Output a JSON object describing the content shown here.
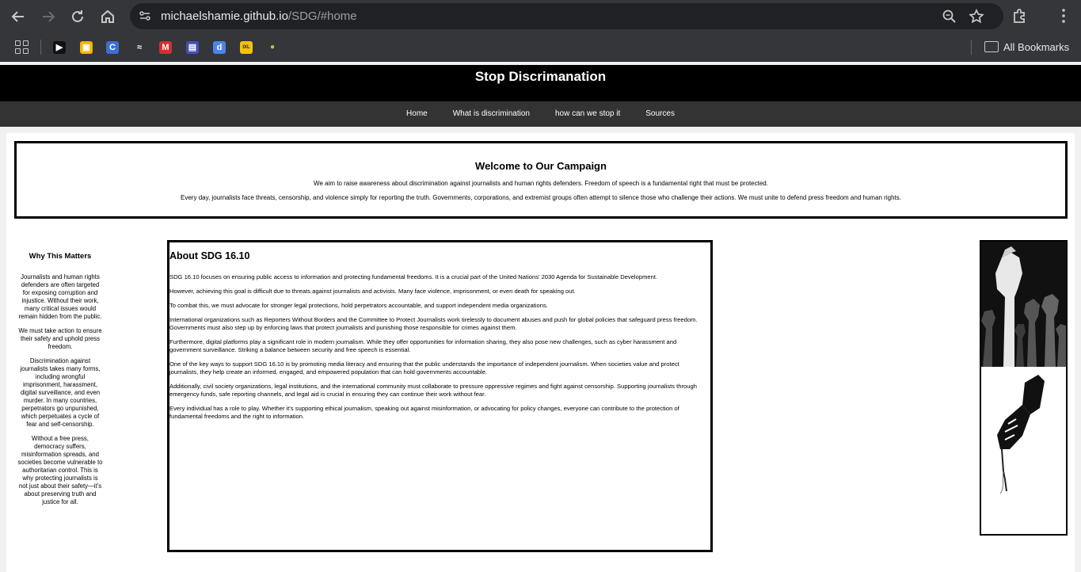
{
  "browser": {
    "url_host": "michaelshamie.github.io",
    "url_path": "/SDG/#home",
    "all_bookmarks_label": "All Bookmarks",
    "bookmarks": [
      {
        "icon": "play-favicon",
        "color": "#111111",
        "glyph": "▶"
      },
      {
        "icon": "slides-favicon",
        "color": "#f4b400",
        "glyph": "▣"
      },
      {
        "icon": "c-favicon",
        "color": "#3b6fd4",
        "glyph": "C"
      },
      {
        "icon": "fish-favicon",
        "color": "#35363a",
        "glyph": "≈"
      },
      {
        "icon": "m-favicon",
        "color": "#d32f2f",
        "glyph": "M"
      },
      {
        "icon": "board-favicon",
        "color": "#3f51b5",
        "glyph": "▤"
      },
      {
        "icon": "d-favicon",
        "color": "#4a86e8",
        "glyph": "d"
      },
      {
        "icon": "ixl-favicon",
        "color": "#f4c20d",
        "glyph": "IXL"
      },
      {
        "icon": "drop-favicon",
        "color": "#35363a",
        "glyph": "●"
      }
    ]
  },
  "site": {
    "title": "Stop Discrimanation",
    "nav": [
      "Home",
      "What is discrimination",
      "how can we stop it",
      "Sources"
    ]
  },
  "welcome": {
    "heading": "Welcome to Our Campaign",
    "p1": "We aim to raise awareness about discrimination against journalists and human rights defenders. Freedom of speech is a fundamental right that must be protected.",
    "p2": "Every day, journalists face threats, censorship, and violence simply for reporting the truth. Governments, corporations, and extremist groups often attempt to silence those who challenge their actions. We must unite to defend press freedom and human rights."
  },
  "sidebar": {
    "heading": "Why This Matters",
    "paragraphs": [
      "Journalists and human rights defenders are often targeted for exposing corruption and injustice. Without their work, many critical issues would remain hidden from the public.",
      "We must take action to ensure their safety and uphold press freedom.",
      "Discrimination against journalists takes many forms, including wrongful imprisonment, harassment, digital surveillance, and even murder. In many countries, perpetrators go unpunished, which perpetuates a cycle of fear and self-censorship.",
      "Without a free press, democracy suffers, misinformation spreads, and societies become vulnerable to authoritarian control. This is why protecting journalists is not just about their safety—it's about preserving truth and justice for all."
    ]
  },
  "about": {
    "heading": "About SDG 16.10",
    "paragraphs": [
      "SDG 16.10 focuses on ensuring public access to information and protecting fundamental freedoms. It is a crucial part of the United Nations' 2030 Agenda for Sustainable Development.",
      "However, achieving this goal is difficult due to threats against journalists and activists. Many face violence, imprisonment, or even death for speaking out.",
      "To combat this, we must advocate for stronger legal protections, hold perpetrators accountable, and support independent media organizations.",
      "International organizations such as Reporters Without Borders and the Committee to Protect Journalists work tirelessly to document abuses and push for global policies that safeguard press freedom. Governments must also step up by enforcing laws that protect journalists and punishing those responsible for crimes against them.",
      "Furthermore, digital platforms play a significant role in modern journalism. While they offer opportunities for information sharing, they also pose new challenges, such as cyber harassment and government surveillance. Striking a balance between security and free speech is essential.",
      "One of the key ways to support SDG 16.10 is by promoting media literacy and ensuring that the public understands the importance of independent journalism. When societies value and protect journalists, they help create an informed, engaged, and empowered population that can hold governments accountable.",
      "Additionally, civil society organizations, legal institutions, and the international community must collaborate to pressure oppressive regimes and fight against censorship. Supporting journalists through emergency funds, safe reporting channels, and legal aid is crucial in ensuring they can continue their work without fear.",
      "Every individual has a role to play. Whether it's supporting ethical journalism, speaking out against misinformation, or advocating for policy changes, everyone can contribute to the protection of fundamental freedoms and the right to information."
    ]
  }
}
